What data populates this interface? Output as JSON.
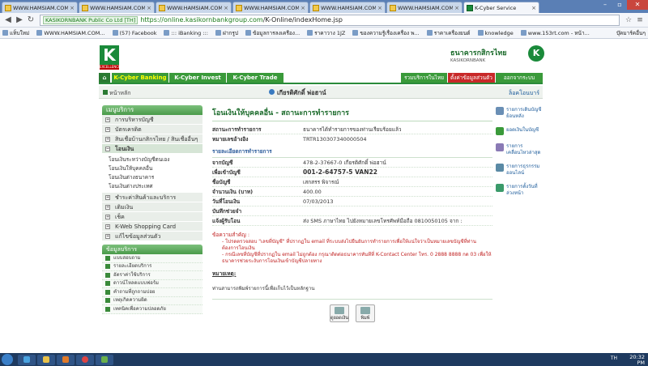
{
  "browser": {
    "tabs": [
      {
        "title": "WWW.HAMSIAM.COM # NO",
        "active": false
      },
      {
        "title": "WWW.HAMSIAM.COM # NO",
        "active": false
      },
      {
        "title": "WWW.HAMSIAM.COM # NO",
        "active": false
      },
      {
        "title": "WWW.HAMSIAM.COM # NO",
        "active": false
      },
      {
        "title": "WWW.HAMSIAM.COM # NO",
        "active": false
      },
      {
        "title": "WWW.HAMSIAM.COM # NO",
        "active": false
      },
      {
        "title": "K-Cyber Service",
        "active": true
      }
    ],
    "ev_label": "KASIKORNBANK Public Co Ltd [TH]",
    "url_host": "https://online.kasikornbankgroup.com",
    "url_path": "/K-Online/indexHome.jsp",
    "bookmarks": [
      "แท็บใหม่",
      "WWW.HAMSIAM.COM...",
      "(57) Facebook",
      "::: iBanking :::",
      "ฝากรูป",
      "ข้อมูลการลงเครือง...",
      "ราคาวาง 1JZ",
      "ของความรู้เรื่องเครื่อง พ...",
      "ราคาเครื่องยนต์",
      "knowledge",
      "www.153rt.com - หน้า..."
    ],
    "bookmarks_other": "บุ๊คมาร์คอื่นๆ"
  },
  "header": {
    "logo_letter": "K",
    "logo_sub": "EXCELLENCE",
    "bank_name_th": "ธนาคารกสิกรไทย",
    "bank_name_en": "KASIKORNBANK",
    "bank_mark": "K"
  },
  "topnav": {
    "home": "⌂",
    "cyber_banking": "K-Cyber Banking",
    "cyber_invest": "K-Cyber Invest",
    "cyber_trade": "K-Cyber Trade",
    "right1": "รวมบริการในไทย",
    "right2": "ตั้งค่าข้อมูลส่วนตัว",
    "right3": "ออกจากระบบ"
  },
  "subnav": {
    "home": "หน้าหลัก",
    "user": "เกียรติศักดิ์ พ่อฮาน์",
    "logout": "ล็อคโอนบาร์"
  },
  "menu": {
    "title": "เมนูบริการ",
    "items": [
      {
        "label": "การบริหารบัญชี",
        "open": false
      },
      {
        "label": "บัตรเครดิต",
        "open": false
      },
      {
        "label": "สินเชื่อบ้านกสิกรไทย / สินเชื่ออื่นๆ",
        "open": false
      },
      {
        "label": "โอนเงิน",
        "open": true
      }
    ],
    "sub_items": [
      "โอนเงินระหว่างบัญชีตนเอง",
      "โอนเงินให้บุคคลอื่น",
      "โอนเงินต่างธนาคาร",
      "โอนเงินต่างประเทศ"
    ],
    "items2": [
      {
        "label": "ชำระค่าสินค้าและบริการ"
      },
      {
        "label": "เติมเงิน"
      },
      {
        "label": "เช็ค"
      },
      {
        "label": "K-Web Shopping Card"
      },
      {
        "label": "แก้ไขข้อมูลส่วนตัว"
      }
    ]
  },
  "services": {
    "title": "ข้อมูลบริการ",
    "items": [
      "แบบสอบถาม",
      "รายละเอียดบริการ",
      "อัตราค่าใช้บริการ",
      "ดาวน์โหลดแบบฟอร์ม",
      "คำถามที่ถูกถามบ่อย",
      "เหตุเกิดความผิด",
      "เทคนิคเพื่อความปลอดภัย"
    ]
  },
  "main": {
    "title": "โอนเงินให้บุคคลอื่น - สถานะการทำรายการ",
    "status_label": "สถานะการทำรายการ",
    "status_value": "ธนาคารได้ทำรายการของท่านเรียบร้อยแล้ว",
    "ref_label": "หมายเลขอ้างอิง",
    "ref_value": "TRTR130307340000504",
    "detail_title": "รายละเอียดการทำรายการ",
    "details": [
      {
        "label": "จากบัญชี",
        "value": "478-2-37667-0 เกียรติศักดิ์ พ่อฮาน์",
        "big": false
      },
      {
        "label": "เพื่อเข้าบัญชี",
        "value": "001-2-64757-5 VAN22",
        "big": true
      },
      {
        "label": "ชื่อบัญชี",
        "value": "เสกสรร พิจารณ์",
        "big": false
      },
      {
        "label": "จำนวนเงิน (บาท)",
        "value": "400.00",
        "big": false
      },
      {
        "label": "วันที่โอนเงิน",
        "value": "07/03/2013",
        "big": false
      },
      {
        "label": "บันทึกช่วยจำ",
        "value": "",
        "big": false
      },
      {
        "label": "แจ้งผู้รับโอน",
        "value": "ส่ง SMS ภาษาไทย ไปยังหมายเลขโทรศัพท์มือถือ 0810050105 จาก :",
        "big": false
      }
    ],
    "note_head": "ข้อความสำคัญ :",
    "notes": [
      "- โปรดตรวจสอบ \"เลขที่บัญชี\" ที่ปรากฏใน email ที่ระบบส่งไปยืนยันการทำรายการเพื่อให้แน่ใจว่าเป็นหมายเลขบัญชีที่ท่านต้องการโอนเงิน",
      "- กรณีเลขที่บัญชีที่ปรากฏใน email ไม่ถูกต้อง กรุณาติดต่อธนาคารทันทีที่ K-Contact Center โทร. 0 2888 8888 กด 03 เพื่อให้ธนาคารช่วยระงับการโอนเงินเข้าบัญชีปลายทาง"
    ],
    "remark_head": "หมายเหตุ:",
    "remark": "ท่านสามารถพิมพ์รายการนี้เพื่อเก็บไว้เป็นหลักฐาน",
    "btn_view": "ดูยอดเงิน",
    "btn_print": "พิมพ์"
  },
  "rightrail": [
    "รายการเดินบัญชีย้อนหลัง",
    "ยอดเงินในบัญชี",
    "รายการเคลื่อนไหวล่าสุด",
    "รายการธุรกรรมออนไลน์",
    "รายการตั้งวันที่ล่วงหน้า"
  ],
  "taskbar": {
    "lang": "TH",
    "time": "20:32",
    "ampm": "PM"
  },
  "colors": {
    "primary": "#1a8a3a",
    "accent": "#c82828",
    "link": "#1a5a9a"
  }
}
